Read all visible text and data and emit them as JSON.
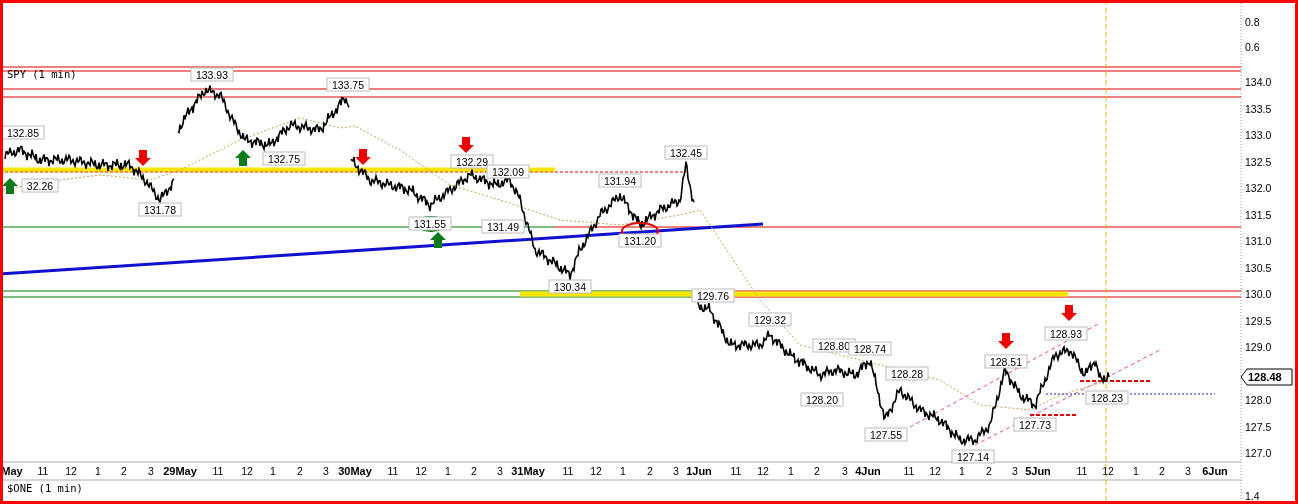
{
  "top_panel": {
    "y_ticks": [
      "0.8",
      "0.6"
    ]
  },
  "main_panel": {
    "title": "SPY (1 min)",
    "y_ticks": [
      "134.0",
      "133.5",
      "133.0",
      "132.5",
      "132.0",
      "131.5",
      "131.0",
      "130.5",
      "130.0",
      "129.5",
      "129.0",
      "128.0",
      "127.5",
      "127.0"
    ],
    "last_price": "128.48",
    "price_labels": [
      "132.85",
      "32.26",
      "131.78",
      "133.93",
      "132.75",
      "133.75",
      "132.29",
      "132.09",
      "131.55",
      "131.49",
      "130.34",
      "131.94",
      "131.20",
      "132.45",
      "129.76",
      "129.32",
      "128.80",
      "128.74",
      "128.28",
      "128.20",
      "127.55",
      "127.14",
      "128.51",
      "127.73",
      "128.93",
      "128.23"
    ]
  },
  "x_axis": {
    "labels": [
      {
        "text": "May",
        "kind": "date"
      },
      {
        "text": "11",
        "kind": "hour"
      },
      {
        "text": "12",
        "kind": "hour"
      },
      {
        "text": "1",
        "kind": "hour"
      },
      {
        "text": "2",
        "kind": "hour"
      },
      {
        "text": "3",
        "kind": "hour"
      },
      {
        "text": "29May",
        "kind": "date"
      },
      {
        "text": "11",
        "kind": "hour"
      },
      {
        "text": "12",
        "kind": "hour"
      },
      {
        "text": "1",
        "kind": "hour"
      },
      {
        "text": "2",
        "kind": "hour"
      },
      {
        "text": "3",
        "kind": "hour"
      },
      {
        "text": "30May",
        "kind": "date"
      },
      {
        "text": "11",
        "kind": "hour"
      },
      {
        "text": "12",
        "kind": "hour"
      },
      {
        "text": "1",
        "kind": "hour"
      },
      {
        "text": "2",
        "kind": "hour"
      },
      {
        "text": "3",
        "kind": "hour"
      },
      {
        "text": "31May",
        "kind": "date"
      },
      {
        "text": "11",
        "kind": "hour"
      },
      {
        "text": "12",
        "kind": "hour"
      },
      {
        "text": "1",
        "kind": "hour"
      },
      {
        "text": "2",
        "kind": "hour"
      },
      {
        "text": "3",
        "kind": "hour"
      },
      {
        "text": "1Jun",
        "kind": "date"
      },
      {
        "text": "11",
        "kind": "hour"
      },
      {
        "text": "12",
        "kind": "hour"
      },
      {
        "text": "1",
        "kind": "hour"
      },
      {
        "text": "2",
        "kind": "hour"
      },
      {
        "text": "3",
        "kind": "hour"
      },
      {
        "text": "4Jun",
        "kind": "date"
      },
      {
        "text": "11",
        "kind": "hour"
      },
      {
        "text": "12",
        "kind": "hour"
      },
      {
        "text": "1",
        "kind": "hour"
      },
      {
        "text": "2",
        "kind": "hour"
      },
      {
        "text": "3",
        "kind": "hour"
      },
      {
        "text": "5Jun",
        "kind": "date"
      },
      {
        "text": "11",
        "kind": "hour"
      },
      {
        "text": "12",
        "kind": "hour"
      },
      {
        "text": "1",
        "kind": "hour"
      },
      {
        "text": "2",
        "kind": "hour"
      },
      {
        "text": "3",
        "kind": "hour"
      },
      {
        "text": "6Jun",
        "kind": "date"
      }
    ]
  },
  "bottom_panel": {
    "title": "$ONE (1 min)",
    "y_ticks": [
      "1.4"
    ]
  }
}
